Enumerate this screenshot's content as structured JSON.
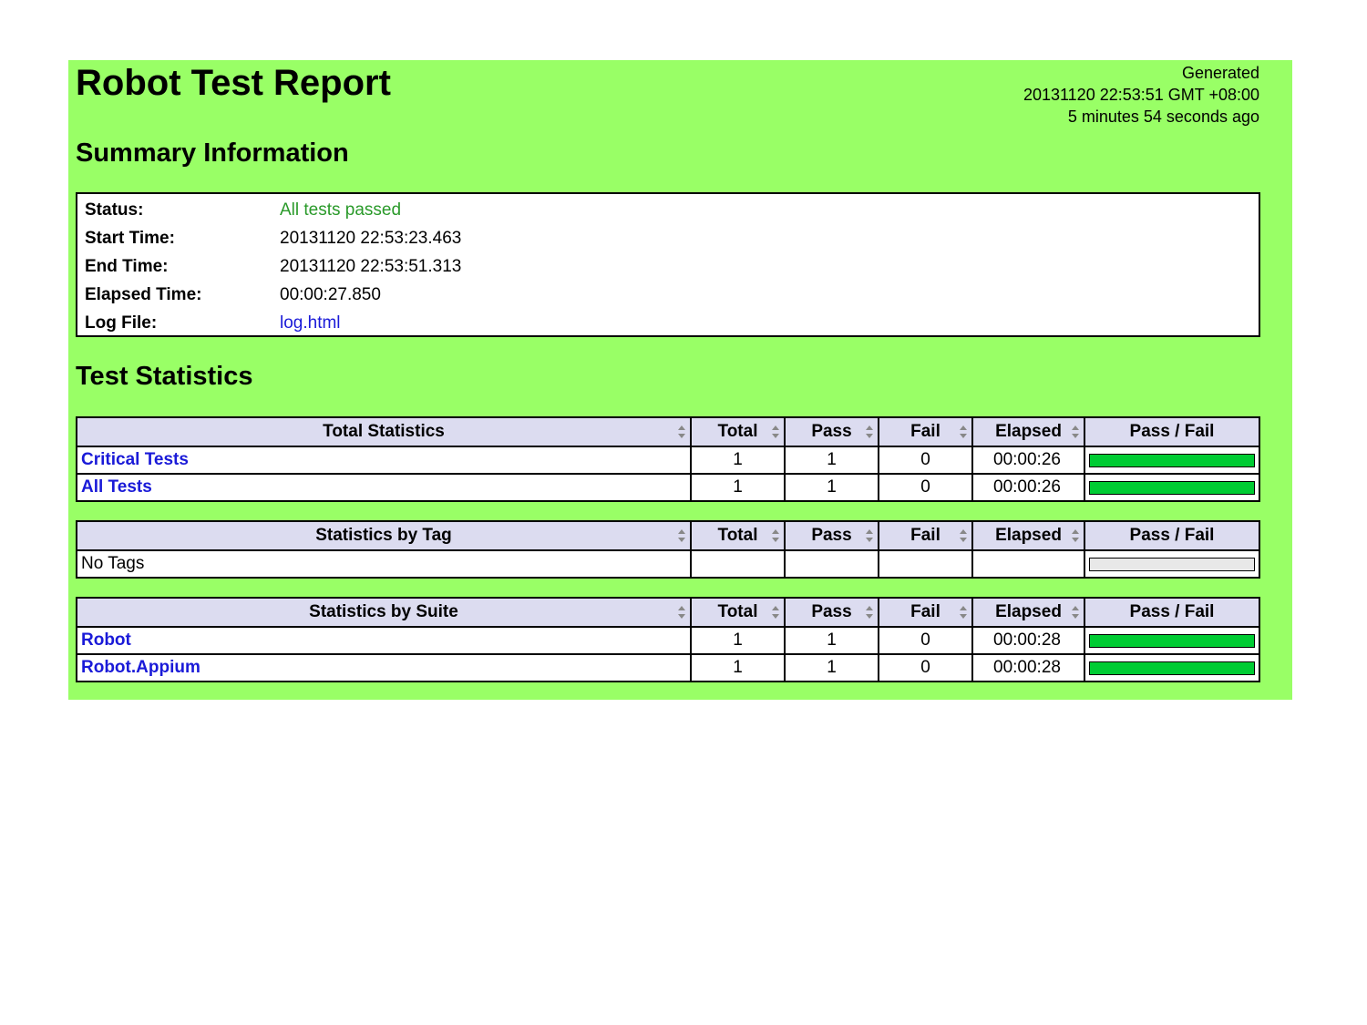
{
  "header": {
    "title": "Robot Test Report",
    "generated_label": "Generated",
    "generated_time": "20131120 22:53:51 GMT +08:00",
    "generated_ago": "5 minutes 54 seconds ago"
  },
  "summary": {
    "title": "Summary Information",
    "rows": {
      "status": {
        "label": "Status:",
        "value": "All tests passed"
      },
      "start": {
        "label": "Start Time:",
        "value": "20131120 22:53:23.463"
      },
      "end": {
        "label": "End Time:",
        "value": "20131120 22:53:51.313"
      },
      "elapsed": {
        "label": "Elapsed Time:",
        "value": "00:00:27.850"
      },
      "log": {
        "label": "Log File:",
        "value": "log.html"
      }
    }
  },
  "statistics": {
    "title": "Test Statistics",
    "columns": {
      "total": "Total",
      "pass": "Pass",
      "fail": "Fail",
      "elapsed": "Elapsed",
      "passfail": "Pass / Fail"
    },
    "total": {
      "heading": "Total Statistics",
      "rows": [
        {
          "name": "Critical Tests",
          "total": "1",
          "pass": "1",
          "fail": "0",
          "elapsed": "00:00:26",
          "pass_ratio": 1.0
        },
        {
          "name": "All Tests",
          "total": "1",
          "pass": "1",
          "fail": "0",
          "elapsed": "00:00:26",
          "pass_ratio": 1.0
        }
      ]
    },
    "tag": {
      "heading": "Statistics by Tag",
      "rows": [
        {
          "name": "No Tags",
          "pass_ratio": 0
        }
      ]
    },
    "suite": {
      "heading": "Statistics by Suite",
      "rows": [
        {
          "name": "Robot",
          "total": "1",
          "pass": "1",
          "fail": "0",
          "elapsed": "00:00:28",
          "pass_ratio": 1.0
        },
        {
          "name": "Robot.Appium",
          "total": "1",
          "pass": "1",
          "fail": "0",
          "elapsed": "00:00:28",
          "pass_ratio": 1.0
        }
      ]
    }
  },
  "colors": {
    "background": "#99ff66",
    "pass": "#00cc33",
    "header_row": "#dcdcf0",
    "link": "#1a1ad8"
  },
  "icons": {
    "sort": "sort-arrows-icon"
  }
}
